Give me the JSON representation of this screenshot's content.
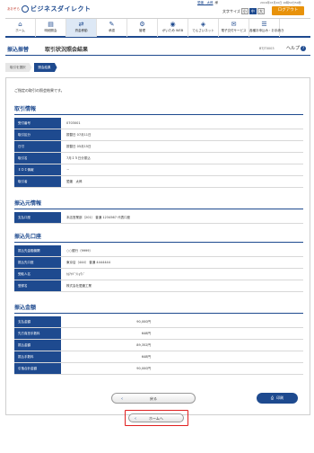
{
  "header": {
    "logo_badge": "あおぞら",
    "logo_text": "ビジネスダイレクト",
    "user_name": "愛媛　太郎",
    "user_suffix": "様",
    "last_login": "2016年03月20日 16時50分50秒",
    "font_size_label": "文字サイズ",
    "font_sizes": [
      "小",
      "中",
      "大"
    ],
    "logout_label": "ログアウト"
  },
  "nav": [
    {
      "icon": "home-icon",
      "glyph": "⌂",
      "label": "ホーム"
    },
    {
      "icon": "account-icon",
      "glyph": "▤",
      "label": "明細照会"
    },
    {
      "icon": "transfer-icon",
      "glyph": "⇄",
      "label": "資金移動",
      "active": true
    },
    {
      "icon": "approval-icon",
      "glyph": "✎",
      "label": "承認"
    },
    {
      "icon": "management-icon",
      "glyph": "⚙",
      "label": "管理"
    },
    {
      "icon": "web-icon",
      "glyph": "◉",
      "label": "がいため WEB"
    },
    {
      "icon": "densai-icon",
      "glyph": "◈",
      "label": "でんさいネット"
    },
    {
      "icon": "e-delivery-icon",
      "glyph": "✉",
      "label": "電子交付サービス"
    },
    {
      "icon": "procedure-icon",
      "glyph": "☰",
      "label": "各種お申込み・お手続き"
    }
  ],
  "title": {
    "category": "振込振替",
    "page": "取引状況照会結果",
    "screen_id": "BTJT0003",
    "help_label": "ヘルプ",
    "help_glyph": "?"
  },
  "breadcrumbs": [
    "取引を選択",
    "照会結果"
  ],
  "message": "ご指定の取引の照会結果です。",
  "sections": {
    "transaction": {
      "title": "取引情報",
      "rows": [
        {
          "k": "受付番号",
          "v": "0703001"
        },
        {
          "k": "取引区分",
          "v": "振替日 07月11日"
        },
        {
          "k": "日付",
          "v": "振替日 05月15日"
        },
        {
          "k": "取引名",
          "v": "7月１５日分振込"
        },
        {
          "k": "ＥＤＩ情報",
          "v": "－"
        },
        {
          "k": "取引者",
          "v": "愛媛　太郎"
        }
      ]
    },
    "source": {
      "title": "振込元情報",
      "rows": [
        {
          "k": "支払口座",
          "v": "本店営業部（201） 普通 1234567 代表口座"
        }
      ]
    },
    "destination": {
      "title": "振込先口座",
      "rows": [
        {
          "k": "振込先金融機関",
          "v": "○○銀行（9999）"
        },
        {
          "k": "振込先口座",
          "v": "東京店（444） 普通 4444444"
        },
        {
          "k": "受取人名",
          "v": "ｶ)ｱｵｿﾞﾗｼｮｳｼﾞ"
        },
        {
          "k": "登録名",
          "v": "株式会社愛媛工業"
        }
      ]
    },
    "amount": {
      "title": "振込金額",
      "rows": [
        {
          "k": "支払金額",
          "v": "90,000円"
        },
        {
          "k": "先方負担手数料",
          "v": "648円"
        },
        {
          "k": "振込金額",
          "v": "89,352円"
        },
        {
          "k": "振込手数料",
          "v": "648円"
        },
        {
          "k": "引落合計金額",
          "v": "90,000円"
        }
      ]
    }
  },
  "buttons": {
    "back_label": "戻る",
    "print_label": "印刷",
    "home_label": "ホームへ"
  }
}
